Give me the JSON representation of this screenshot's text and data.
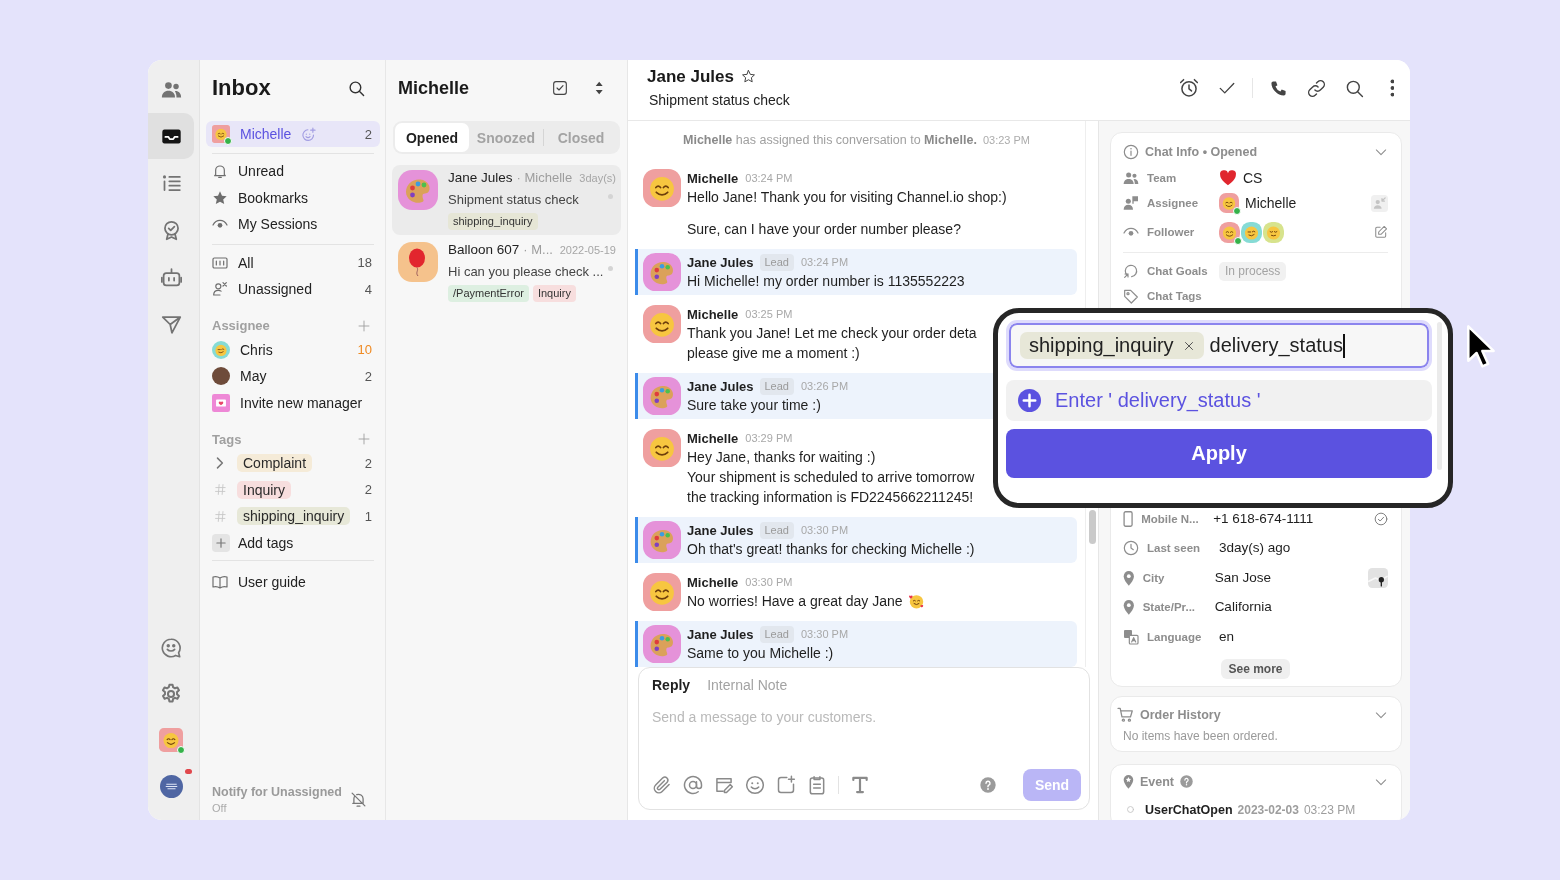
{
  "rail": {
    "items": [
      {
        "selected": false
      },
      {
        "selected": true
      },
      {
        "selected": false
      },
      {
        "selected": false
      },
      {
        "selected": false
      },
      {
        "selected": false
      }
    ],
    "profile": {
      "online": true
    },
    "workspace": {
      "notification": true
    }
  },
  "inbox": {
    "title": "Inbox",
    "me": {
      "label": "Michelle",
      "count": "2",
      "online": true,
      "selected": true
    },
    "views": [
      {
        "label": "Unread",
        "selected": false
      },
      {
        "label": "Bookmarks",
        "selected": false
      },
      {
        "label": "My Sessions",
        "selected": false
      }
    ],
    "filters": [
      {
        "label": "All",
        "count": "18",
        "selected": false
      },
      {
        "label": "Unassigned",
        "count": "4",
        "selected": false
      }
    ],
    "assignee_heading": "Assignee",
    "assignees": [
      {
        "label": "Chris",
        "count": "10",
        "highlighted": true,
        "selected": false
      },
      {
        "label": "May",
        "count": "2",
        "highlighted": false,
        "selected": false
      }
    ],
    "invite": "Invite new manager",
    "tags_heading": "Tags",
    "tags": [
      {
        "kind": "folder",
        "label": "Complaint",
        "count": "2",
        "color": "#f5ebd8",
        "selected": false
      },
      {
        "kind": "tag",
        "label": "Inquiry",
        "count": "2",
        "color": "#f7dede",
        "selected": false
      },
      {
        "kind": "tag",
        "label": "shipping_inquiry",
        "count": "1",
        "color": "#e7e8d8",
        "selected": false
      }
    ],
    "add_tags": "Add tags",
    "user_guide": {
      "label": "User guide",
      "selected": false
    },
    "notify": {
      "label": "Notify for Unassigned",
      "value": "Off"
    }
  },
  "conversations": {
    "title": "Michelle",
    "tabs": [
      {
        "label": "Opened",
        "selected": true
      },
      {
        "label": "Snoozed",
        "selected": false
      },
      {
        "label": "Closed",
        "selected": false
      }
    ],
    "items": [
      {
        "name": "Jane Jules",
        "assignee": "· Michelle",
        "time": "3day(s)",
        "preview": "Shipment status check",
        "tags": [
          {
            "label": "shipping_inquiry",
            "color": "#e6e6d6"
          }
        ],
        "selected": true
      },
      {
        "name": "Balloon 607",
        "assignee": "· M...",
        "time": "2022-05-19",
        "preview": "Hi can you please check ...",
        "tags": [
          {
            "label": "/PaymentError",
            "color": "#ddefe1"
          },
          {
            "label": "Inquiry",
            "color": "#f7dede"
          }
        ],
        "selected": false
      }
    ]
  },
  "chat": {
    "title": "Jane Jules",
    "starred": false,
    "subtitle": "Shipment status check",
    "system_message": {
      "text": "**Michelle** has assigned this conversation to **Michelle.**",
      "time": "03:23 PM"
    },
    "messages": [
      {
        "kind": "agent",
        "sender": "Michelle",
        "time": "03:24 PM",
        "paragraphs": [
          "Hello Jane! Thank you for visiting Channel.io shop:)",
          "Sure, can I have your order number please?"
        ]
      },
      {
        "kind": "customer",
        "sender": "Jane Jules",
        "badge": "Lead",
        "time": "03:24 PM",
        "paragraphs": [
          "Hi Michelle! my order number is 1135552223"
        ]
      },
      {
        "kind": "agent",
        "sender": "Michelle",
        "time": "03:25 PM",
        "paragraphs": [
          "Thank you Jane! Let me check your order deta\nplease give me a moment :)"
        ]
      },
      {
        "kind": "customer",
        "sender": "Jane Jules",
        "badge": "Lead",
        "time": "03:26 PM",
        "paragraphs": [
          "Sure take your time :)"
        ]
      },
      {
        "kind": "agent",
        "sender": "Michelle",
        "time": "03:29 PM",
        "paragraphs": [
          "Hey Jane, thanks for waiting :)\nYour shipment is scheduled to arrive tomorrow\nthe tracking information is FD2245662211245!"
        ]
      },
      {
        "kind": "customer",
        "sender": "Jane Jules",
        "badge": "Lead",
        "time": "03:30 PM",
        "paragraphs": [
          "Oh that's great! thanks for checking Michelle :)"
        ]
      },
      {
        "kind": "agent",
        "sender": "Michelle",
        "time": "03:30 PM",
        "paragraphs": [
          "No worries! Have a great day Jane"
        ],
        "trailing_emoji": true
      },
      {
        "kind": "customer",
        "sender": "Jane Jules",
        "badge": "Lead",
        "time": "03:30 PM",
        "paragraphs": [
          "Same to you Michelle :)"
        ]
      }
    ],
    "composer": {
      "tabs": [
        {
          "label": "Reply",
          "selected": true
        },
        {
          "label": "Internal Note",
          "selected": false
        }
      ],
      "placeholder": "Send a message to your customers.",
      "send": {
        "label": "Send",
        "disabled": true
      }
    }
  },
  "chat_info": {
    "title": "Chat Info • Opened",
    "team": {
      "label": "Team",
      "value": "CS"
    },
    "assignee": {
      "label": "Assignee",
      "value": "Michelle",
      "online": true
    },
    "follower": {
      "label": "Follower",
      "avatars": [
        {
          "online": true
        },
        {
          "online": false
        },
        {
          "online": false
        }
      ]
    },
    "goals": {
      "label": "Chat Goals",
      "value": "In process"
    },
    "tags": {
      "label": "Chat Tags"
    },
    "profile": [
      {
        "label": "Mobile N...",
        "value": "+1 618-674-1111",
        "verified": true
      },
      {
        "label": "Last seen",
        "value": "3day(s) ago",
        "verified": false
      },
      {
        "label": "City",
        "value": "San Jose",
        "verified": false
      },
      {
        "label": "State/Pr...",
        "value": "California",
        "verified": false
      },
      {
        "label": "Language",
        "value": "en",
        "verified": false
      }
    ],
    "see_more": "See more"
  },
  "order_history": {
    "title": "Order History",
    "empty_text": "No items have been ordered."
  },
  "event": {
    "title": "Event",
    "items": [
      {
        "name": "UserChatOpen",
        "date": "2023-02-03",
        "time": "03:23 PM"
      }
    ]
  },
  "tag_popup": {
    "chips": [
      {
        "label": "shipping_inquiry"
      }
    ],
    "value": "delivery_status",
    "option": "Enter ' delivery_status '",
    "apply": "Apply"
  }
}
